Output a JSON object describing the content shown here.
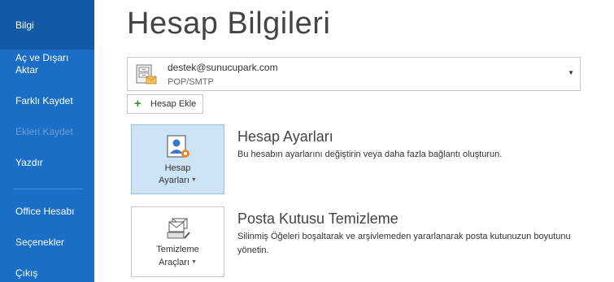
{
  "sidebar": {
    "items": [
      {
        "label": "Bilgi"
      },
      {
        "label": "Aç ve Dışarı Aktar"
      },
      {
        "label": "Farklı Kaydet"
      },
      {
        "label": "Ekleri Kaydet"
      },
      {
        "label": "Yazdır"
      },
      {
        "label": "Office Hesabı"
      },
      {
        "label": "Seçenekler"
      },
      {
        "label": "Çıkış"
      }
    ]
  },
  "header": {
    "title": "Hesap Bilgileri"
  },
  "account": {
    "email": "destek@sunucupark.com",
    "type": "POP/SMTP",
    "add_label": "Hesap Ekle"
  },
  "sections": [
    {
      "button_line1": "Hesap",
      "button_line2": "Ayarları",
      "title": "Hesap Ayarları",
      "description": "Bu hesabın ayarlarını değiştirin veya daha fazla bağlantı oluşturun."
    },
    {
      "button_line1": "Temizleme",
      "button_line2": "Araçları",
      "title": "Posta Kutusu Temizleme",
      "description": "Silinmiş Öğeleri boşaltarak ve arşivlemeden yararlanarak posta kutunuzun boyutunu yönetin."
    }
  ],
  "colors": {
    "sidebar": "#1a6ec5",
    "sidebar_active": "#135aa5",
    "selected_button": "#cde4f7"
  }
}
